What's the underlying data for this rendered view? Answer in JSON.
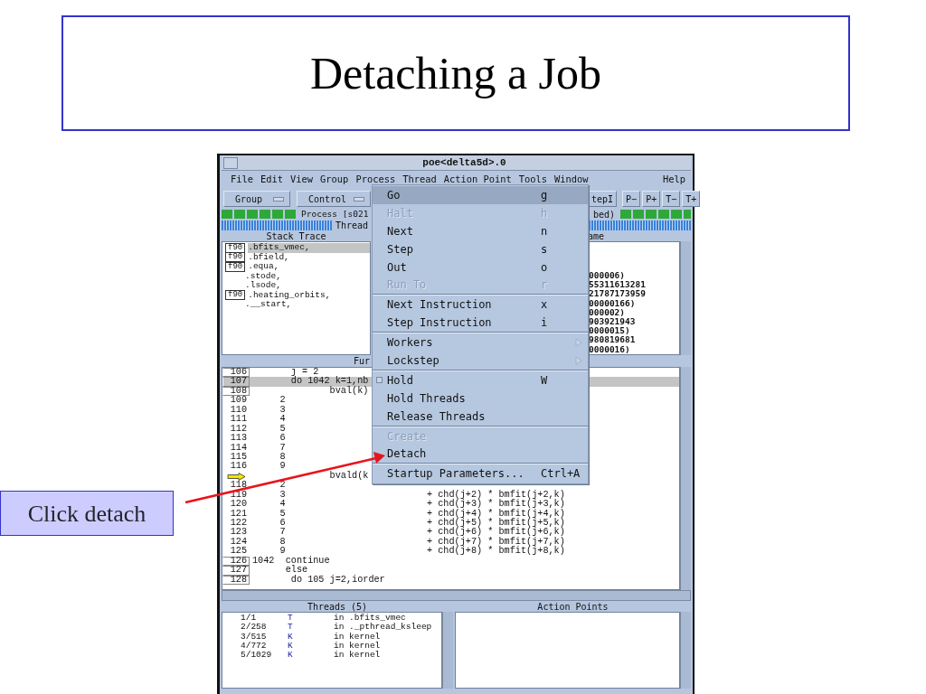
{
  "slide": {
    "title": "Detaching a Job",
    "callout": "Click detach"
  },
  "window": {
    "title": "poe<delta5d>.0"
  },
  "menubar": {
    "left": [
      "File",
      "Edit",
      "View",
      "Group",
      "Process",
      "Thread",
      "Action Point",
      "Tools",
      "Window"
    ],
    "right": "Help"
  },
  "toolbar": {
    "dropdowns": [
      "Group",
      "Control"
    ],
    "buttons": [
      "tepI",
      "P−",
      "P+",
      "T−",
      "T+"
    ]
  },
  "process_bar": {
    "left": "Process [s021",
    "right": "bed)"
  },
  "thread_bar": {
    "label": "Thread"
  },
  "stack_trace": {
    "header": "Stack Trace",
    "frames": [
      {
        "lang": "f90",
        "name": ".bfits_vmec,",
        "selected": true
      },
      {
        "lang": "f90",
        "name": ".bfield,",
        "selected": false
      },
      {
        "lang": "f90",
        "name": ".equa,",
        "selected": false
      },
      {
        "name": ".stode,",
        "selected": false
      },
      {
        "name": ".lsode,",
        "selected": false
      },
      {
        "lang": "f90",
        "name": ".heating_orbits,",
        "selected": false
      },
      {
        "name": ".__start,",
        "selected": false
      }
    ]
  },
  "stack_frame": {
    "header": "ame",
    "values": [
      "000006)",
      "55311613281",
      "21787173959",
      "00000166)",
      "000002)",
      "903921943",
      "0000015)",
      "980819681",
      "0000016)"
    ]
  },
  "source": {
    "header": "Fur",
    "lines": [
      {
        "num": "106",
        "boxed": true,
        "selected": false,
        "code": "       j = 2"
      },
      {
        "num": "107",
        "boxed": true,
        "selected": true,
        "code": "       do 1042 k=1,nb"
      },
      {
        "num": "108",
        "boxed": true,
        "selected": false,
        "code": "              bval(k)"
      },
      {
        "num": "109",
        "boxed": false,
        "selected": false,
        "code": "     2"
      },
      {
        "num": "110",
        "boxed": false,
        "selected": false,
        "code": "     3"
      },
      {
        "num": "111",
        "boxed": false,
        "selected": false,
        "code": "     4"
      },
      {
        "num": "112",
        "boxed": false,
        "selected": false,
        "code": "     5"
      },
      {
        "num": "113",
        "boxed": false,
        "selected": false,
        "code": "     6"
      },
      {
        "num": "114",
        "boxed": false,
        "selected": false,
        "code": "     7"
      },
      {
        "num": "115",
        "boxed": false,
        "selected": false,
        "code": "     8"
      },
      {
        "num": "116",
        "boxed": false,
        "selected": false,
        "code": "     9"
      },
      {
        "pc": true,
        "boxed": false,
        "selected": false,
        "code": "              bvald(k"
      },
      {
        "num": "118",
        "boxed": false,
        "selected": false,
        "code": "     2"
      },
      {
        "num": "119",
        "boxed": false,
        "selected": false,
        "code": "     3",
        "expr": "+ chd(j+2) * bmfit(j+2,k)"
      },
      {
        "num": "120",
        "boxed": false,
        "selected": false,
        "code": "     4",
        "expr": "+ chd(j+3) * bmfit(j+3,k)"
      },
      {
        "num": "121",
        "boxed": false,
        "selected": false,
        "code": "     5",
        "expr": "+ chd(j+4) * bmfit(j+4,k)"
      },
      {
        "num": "122",
        "boxed": false,
        "selected": false,
        "code": "     6",
        "expr": "+ chd(j+5) * bmfit(j+5,k)"
      },
      {
        "num": "123",
        "boxed": false,
        "selected": false,
        "code": "     7",
        "expr": "+ chd(j+6) * bmfit(j+6,k)"
      },
      {
        "num": "124",
        "boxed": false,
        "selected": false,
        "code": "     8",
        "expr": "+ chd(j+7) * bmfit(j+7,k)"
      },
      {
        "num": "125",
        "boxed": false,
        "selected": false,
        "code": "     9",
        "expr": "+ chd(j+8) * bmfit(j+8,k)"
      },
      {
        "num": "126",
        "boxed": true,
        "selected": false,
        "code": "1042  continue"
      },
      {
        "num": "127",
        "boxed": true,
        "selected": false,
        "code": "      else"
      },
      {
        "num": "128",
        "boxed": true,
        "selected": false,
        "code": "       do 105 j=2,iorder"
      }
    ]
  },
  "threads": {
    "header": "Threads (5)",
    "rows": [
      {
        "id": "1/1",
        "type": "T",
        "location": "in .bfits_vmec"
      },
      {
        "id": "2/258",
        "type": "T",
        "location": "in ._pthread_ksleep"
      },
      {
        "id": "3/515",
        "type": "K",
        "location": "in kernel"
      },
      {
        "id": "4/772",
        "type": "K",
        "location": "in kernel"
      },
      {
        "id": "5/1029",
        "type": "K",
        "location": "in kernel"
      }
    ]
  },
  "action_points": {
    "header": "Action Points"
  },
  "process_menu": {
    "items": [
      {
        "kind": "command",
        "label": "Go",
        "shortcut": "g",
        "disabled": false,
        "selected": true
      },
      {
        "kind": "command",
        "label": "Halt",
        "shortcut": "h",
        "disabled": true,
        "selected": false
      },
      {
        "kind": "command",
        "label": "Next",
        "shortcut": "n",
        "disabled": false,
        "selected": false
      },
      {
        "kind": "command",
        "label": "Step",
        "shortcut": "s",
        "disabled": false,
        "selected": false
      },
      {
        "kind": "command",
        "label": "Out",
        "shortcut": "o",
        "disabled": false,
        "selected": false
      },
      {
        "kind": "command",
        "label": "Run To",
        "shortcut": "r",
        "disabled": true,
        "selected": false
      },
      {
        "kind": "separator"
      },
      {
        "kind": "command",
        "label": "Next Instruction",
        "shortcut": "x",
        "disabled": false,
        "selected": false
      },
      {
        "kind": "command",
        "label": "Step Instruction",
        "shortcut": "i",
        "disabled": false,
        "selected": false
      },
      {
        "kind": "separator"
      },
      {
        "kind": "submenu",
        "label": "Workers",
        "disabled": false,
        "selected": false
      },
      {
        "kind": "submenu",
        "label": "Lockstep",
        "disabled": false,
        "selected": false
      },
      {
        "kind": "separator"
      },
      {
        "kind": "toggle",
        "label": "Hold",
        "shortcut": "W",
        "checked": false,
        "disabled": false,
        "selected": false
      },
      {
        "kind": "command",
        "label": "Hold Threads",
        "disabled": false,
        "selected": false
      },
      {
        "kind": "command",
        "label": "Release Threads",
        "disabled": false,
        "selected": false
      },
      {
        "kind": "separator"
      },
      {
        "kind": "command",
        "label": "Create",
        "disabled": true,
        "selected": false
      },
      {
        "kind": "command",
        "label": "Detach",
        "disabled": false,
        "selected": false
      },
      {
        "kind": "separator"
      },
      {
        "kind": "command",
        "label": "Startup Parameters...",
        "shortcut": "Ctrl+A",
        "disabled": false,
        "selected": false
      }
    ]
  }
}
